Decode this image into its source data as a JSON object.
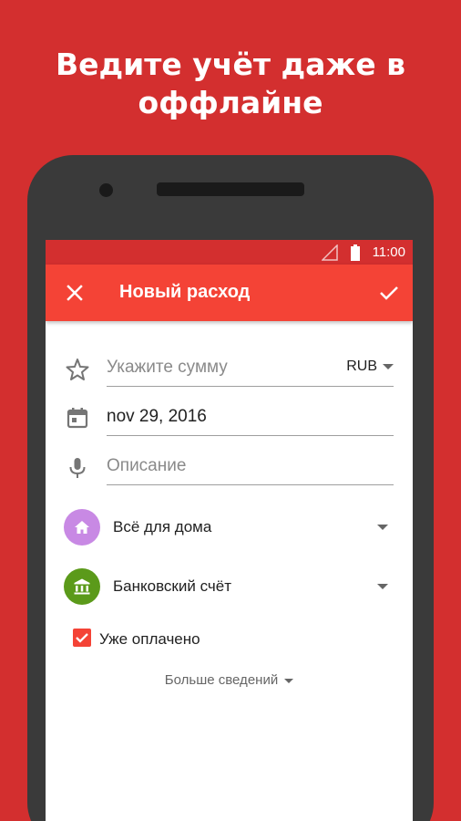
{
  "promo": {
    "line1": "Ведите учёт даже в",
    "line2": "оффлайне"
  },
  "status_bar": {
    "time": "11:00"
  },
  "app_bar": {
    "title": "Новый расход"
  },
  "form": {
    "amount_placeholder": "Укажите сумму",
    "currency": "RUB",
    "date": "nov 29, 2016",
    "description_placeholder": "Описание"
  },
  "category": {
    "label": "Всё для дома",
    "color": "#c889e4",
    "icon": "home-icon"
  },
  "account": {
    "label": "Банковский счёт",
    "color": "#5b9a1a",
    "icon": "bank-icon"
  },
  "paid": {
    "label": "Уже оплачено",
    "checked": true
  },
  "more": {
    "label": "Больше сведений"
  },
  "colors": {
    "background": "#d32f2f",
    "app_bar": "#f44336",
    "status_bar": "#d32f2f"
  }
}
